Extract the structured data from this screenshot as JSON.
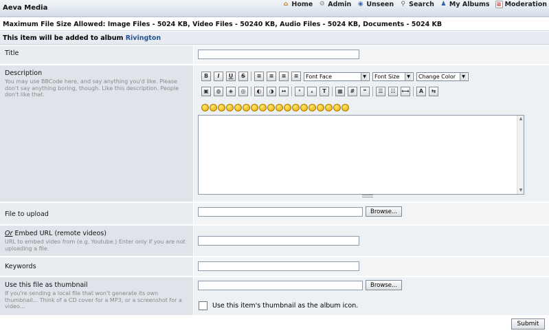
{
  "app": {
    "title": "Aeva Media"
  },
  "nav": [
    {
      "label": "Home",
      "icon": "home-icon"
    },
    {
      "label": "Admin",
      "icon": "gear-icon"
    },
    {
      "label": "Unseen",
      "icon": "eye-icon"
    },
    {
      "label": "Search",
      "icon": "search-icon"
    },
    {
      "label": "My Albums",
      "icon": "user-icon"
    },
    {
      "label": "Moderation",
      "icon": "document-icon"
    }
  ],
  "info": {
    "max_size": "Maximum File Size Allowed: Image Files - 5024 KB, Video Files - 50240 KB, Audio Files - 5024 KB, Documents - 5024 KB",
    "album_prefix": "This item will be added to album",
    "album_name": "Rivington"
  },
  "form": {
    "title": {
      "label": "Title",
      "value": ""
    },
    "description": {
      "label": "Description",
      "hint": "You may use BBCode here, and say anything you'd like. Please don't say anything boring, though. Like this description. People don't like that.",
      "font_face": "Font Face",
      "font_size": "Font Size",
      "color": "Change Color",
      "buttons": [
        "B",
        "I",
        "U",
        "S"
      ]
    },
    "file": {
      "label": "File to upload",
      "browse": "Browse..."
    },
    "embed": {
      "label_or": "Or",
      "label_rest": " Embed URL (remote videos)",
      "hint": "URL to embed video from (e.g. Youtube.) Enter only if you are not uploading a file."
    },
    "keywords": {
      "label": "Keywords"
    },
    "thumbnail": {
      "label": "Use this file as thumbnail",
      "hint": "If you're sending a local file that won't generate its own thumbnail... Think of a CD cover for a MP3, or a screenshot for a video...",
      "browse": "Browse...",
      "album_icon": "Use this item's thumbnail as the album icon."
    },
    "submit": "Submit"
  }
}
